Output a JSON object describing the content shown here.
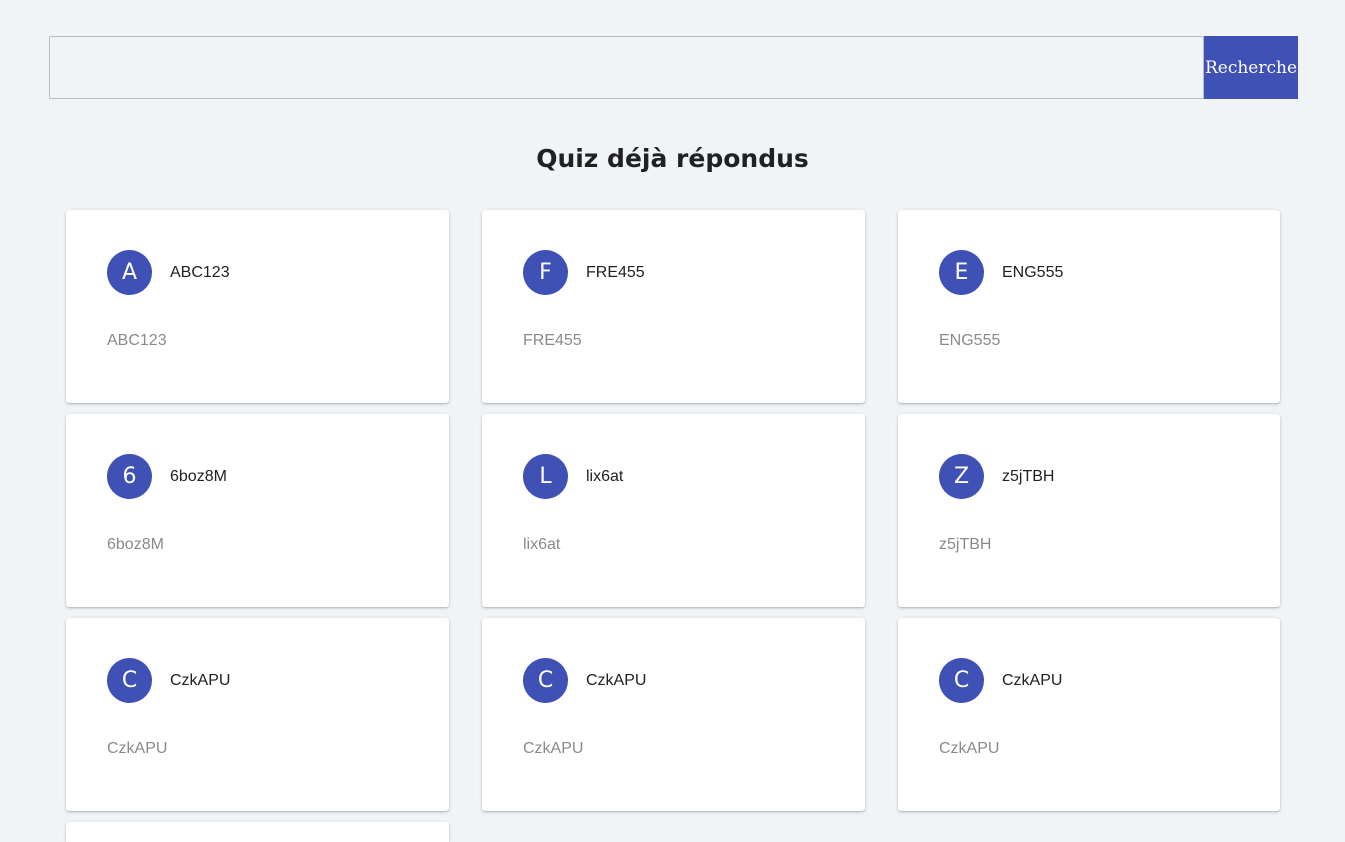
{
  "search": {
    "value": "",
    "placeholder": "",
    "button_label": "Recherche"
  },
  "page_title": "Quiz déjà répondus",
  "quizzes": [
    {
      "initial": "A",
      "title": "ABC123",
      "subtitle": "ABC123"
    },
    {
      "initial": "F",
      "title": "FRE455",
      "subtitle": "FRE455"
    },
    {
      "initial": "E",
      "title": "ENG555",
      "subtitle": "ENG555"
    },
    {
      "initial": "6",
      "title": "6boz8M",
      "subtitle": "6boz8M"
    },
    {
      "initial": "L",
      "title": "lix6at",
      "subtitle": "lix6at"
    },
    {
      "initial": "Z",
      "title": "z5jTBH",
      "subtitle": "z5jTBH"
    },
    {
      "initial": "C",
      "title": "CzkAPU",
      "subtitle": "CzkAPU"
    },
    {
      "initial": "C",
      "title": "CzkAPU",
      "subtitle": "CzkAPU"
    },
    {
      "initial": "C",
      "title": "CzkAPU",
      "subtitle": "CzkAPU"
    }
  ],
  "colors": {
    "accent": "#3f51b5",
    "background": "#f0f4f7"
  }
}
